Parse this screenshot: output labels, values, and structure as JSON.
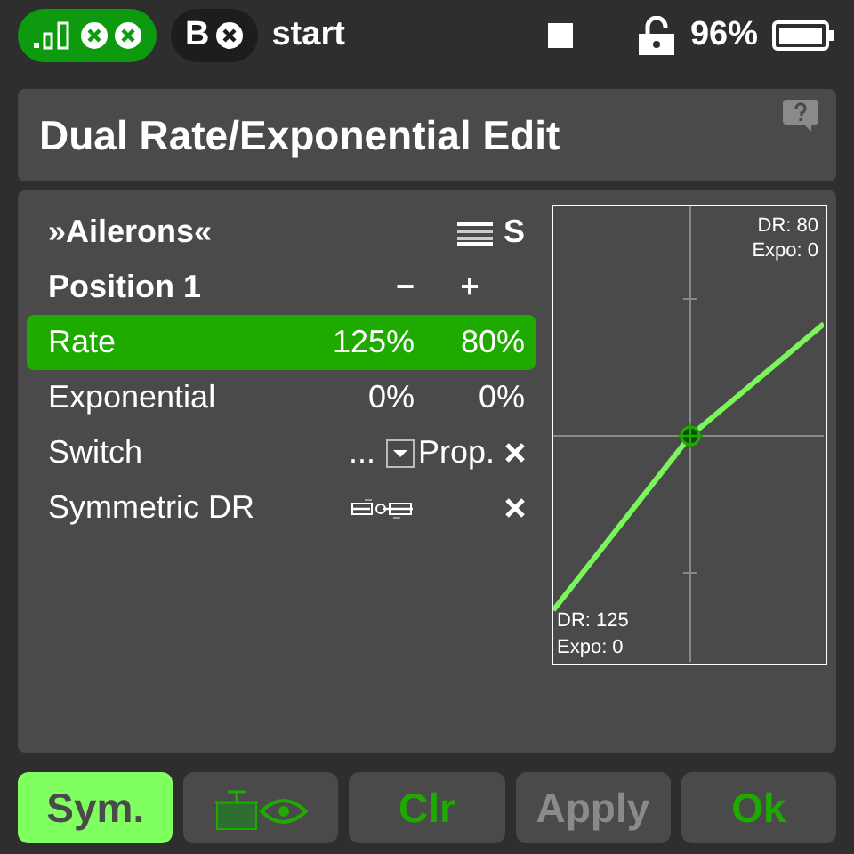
{
  "status_bar": {
    "trainer": "B",
    "model": "start",
    "battery": "96%"
  },
  "title": "Dual Rate/Exponential Edit",
  "function": "»Ailerons«",
  "function_tag": "S",
  "header": {
    "label": "Position 1",
    "minus": "−",
    "plus": "+"
  },
  "rows": [
    {
      "kind": "values",
      "label": "Rate",
      "minus": "125%",
      "plus": "80%",
      "selected": true
    },
    {
      "kind": "values",
      "label": "Exponential",
      "minus": "0%",
      "plus": "0%",
      "selected": false
    },
    {
      "kind": "switch",
      "label": "Switch",
      "minus": "...",
      "plus": "Prop.",
      "selected": false
    },
    {
      "kind": "symmetric",
      "label": "Symmetric DR",
      "selected": false
    }
  ],
  "graph": {
    "top_dr": "DR: 80",
    "top_expo": "Expo: 0",
    "bottom_dr": "DR: 125",
    "bottom_expo": "Expo: 0"
  },
  "buttons": [
    {
      "kind": "text",
      "label": "Sym.",
      "selected": true,
      "disabled": false
    },
    {
      "kind": "icon",
      "selected": false
    },
    {
      "kind": "text",
      "label": "Clr",
      "selected": false,
      "disabled": false
    },
    {
      "kind": "text",
      "label": "Apply",
      "selected": false,
      "disabled": true
    },
    {
      "kind": "text",
      "label": "Ok",
      "selected": false,
      "disabled": false
    }
  ]
}
